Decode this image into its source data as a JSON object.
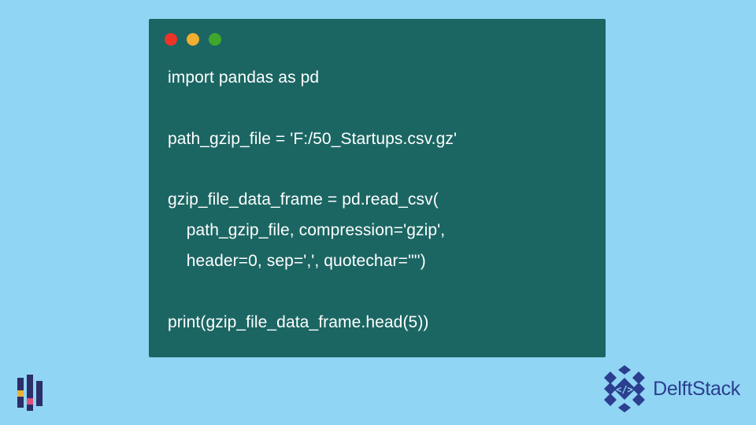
{
  "code": {
    "lines": [
      "import pandas as pd",
      "",
      "path_gzip_file = 'F:/50_Startups.csv.gz'",
      "",
      "gzip_file_data_frame = pd.read_csv(",
      "    path_gzip_file, compression='gzip',",
      "    header=0, sep=',', quotechar='\"')",
      "",
      "print(gzip_file_data_frame.head(5))"
    ]
  },
  "brand": {
    "name": "DelftStack"
  }
}
